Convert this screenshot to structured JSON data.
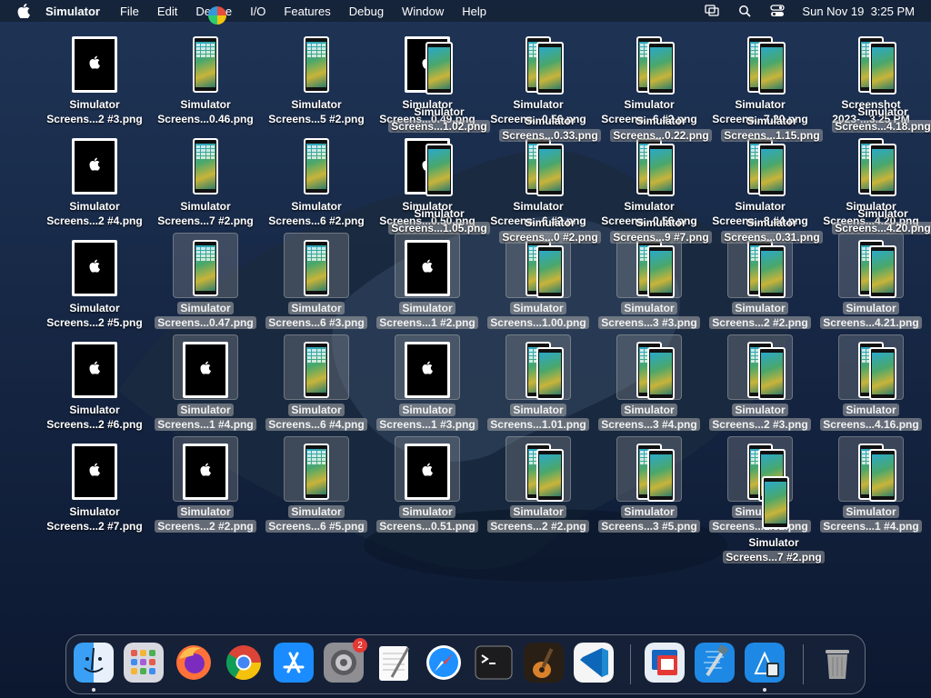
{
  "menubar": {
    "app_name": "Simulator",
    "menus": [
      "File",
      "Edit",
      "Device",
      "I/O",
      "Features",
      "Debug",
      "Window",
      "Help"
    ],
    "clock": "Sun Nov 19  3:25 PM",
    "icons": [
      "apple-icon",
      "screen-mirroring-icon",
      "spotlight-search-icon",
      "control-center-icon"
    ]
  },
  "desktop": {
    "columns": [
      [
        {
          "l1": "Simulator",
          "l2": "Screens...2 #3.png",
          "thumb": "black",
          "selected": false
        },
        {
          "l1": "Simulator",
          "l2": "Screens...2 #4.png",
          "thumb": "black",
          "selected": false
        },
        {
          "l1": "Simulator",
          "l2": "Screens...2 #5.png",
          "thumb": "black",
          "selected": false
        },
        {
          "l1": "Simulator",
          "l2": "Screens...2 #6.png",
          "thumb": "black",
          "selected": false
        },
        {
          "l1": "Simulator",
          "l2": "Screens...2 #7.png",
          "thumb": "black",
          "selected": false
        }
      ],
      [
        {
          "l1": "Simulator",
          "l2": "Screens...0.46.png",
          "thumb": "phone",
          "selected": false
        },
        {
          "l1": "Simulator",
          "l2": "Screens...7 #2.png",
          "thumb": "phone",
          "selected": false
        },
        {
          "l1": "Simulator",
          "l2": "Screens...0.47.png",
          "thumb": "phone",
          "selected": true
        },
        {
          "l1": "Simulator",
          "l2": "Screens...1 #4.png",
          "thumb": "black",
          "selected": true
        },
        {
          "l1": "Simulator",
          "l2": "Screens...2 #2.png",
          "thumb": "black",
          "selected": true
        }
      ],
      [
        {
          "l1": "Simulator",
          "l2": "Screens...5 #2.png",
          "thumb": "phone",
          "selected": false
        },
        {
          "l1": "Simulator",
          "l2": "Screens...6 #2.png",
          "thumb": "phone",
          "selected": false
        },
        {
          "l1": "Simulator",
          "l2": "Screens...6 #3.png",
          "thumb": "phone",
          "selected": true
        },
        {
          "l1": "Simulator",
          "l2": "Screens...6 #4.png",
          "thumb": "phone",
          "selected": true
        },
        {
          "l1": "Simulator",
          "l2": "Screens...6 #5.png",
          "thumb": "phone",
          "selected": true
        }
      ],
      [
        {
          "l1": "Simulator",
          "l2": "Screens...0.49.png",
          "thumb": "black",
          "selected": false
        },
        {
          "l1": "Simulator",
          "l2": "Screens...0.50.png",
          "thumb": "black",
          "selected": false
        },
        {
          "l1": "Simulator",
          "l2": "Screens...1 #2.png",
          "thumb": "black",
          "selected": true
        },
        {
          "l1": "Simulator",
          "l2": "Screens...1 #3.png",
          "thumb": "black",
          "selected": true
        },
        {
          "l1": "Simulator",
          "l2": "Screens...0.51.png",
          "thumb": "black",
          "selected": true
        }
      ],
      [
        {
          "l1": "Simulator",
          "l2": "Screens...0.56.png",
          "thumb": "phone",
          "selected": false
        },
        {
          "l1": "Simulator",
          "l2": "Screens...6 #2.png",
          "thumb": "phone",
          "selected": false
        },
        {
          "l1": "Simulator",
          "l2": "Screens...1.00.png",
          "thumb": "phone",
          "selected": true
        },
        {
          "l1": "Simulator",
          "l2": "Screens...1.01.png",
          "thumb": "phone",
          "selected": true
        },
        {
          "l1": "Simulator",
          "l2": "Screens...2 #2.png",
          "thumb": "phone",
          "selected": true
        }
      ],
      [
        {
          "l1": "Simulator",
          "l2": "Screens...6 #2.png",
          "thumb": "phone",
          "selected": false
        },
        {
          "l1": "Simulator",
          "l2": "Screens...0.56.png",
          "thumb": "phone",
          "selected": false
        },
        {
          "l1": "Simulator",
          "l2": "Screens...3 #3.png",
          "thumb": "phone",
          "selected": true
        },
        {
          "l1": "Simulator",
          "l2": "Screens...3 #4.png",
          "thumb": "phone",
          "selected": true
        },
        {
          "l1": "Simulator",
          "l2": "Screens...3 #5.png",
          "thumb": "phone",
          "selected": true
        }
      ],
      [
        {
          "l1": "Simulator",
          "l2": "Screens...7.20.png",
          "thumb": "phone",
          "selected": false
        },
        {
          "l1": "Simulator",
          "l2": "Screens...8 #4.png",
          "thumb": "phone",
          "selected": false
        },
        {
          "l1": "Simulator",
          "l2": "Screens...2 #2.png",
          "thumb": "phone",
          "selected": true
        },
        {
          "l1": "Simulator",
          "l2": "Screens...2 #3.png",
          "thumb": "phone",
          "selected": true
        },
        {
          "l1": "Simulator",
          "l2": "Screens...1.32.png",
          "thumb": "phone",
          "selected": true
        }
      ],
      [
        {
          "l1": "Screenshot",
          "l2": "2023-...3.25 PM",
          "thumb": "phone",
          "selected": false
        },
        {
          "l1": "Simulator",
          "l2": "Screens...4.20.png",
          "thumb": "phone",
          "selected": false
        },
        {
          "l1": "Simulator",
          "l2": "Screens...4.21.png",
          "thumb": "phone",
          "selected": true
        },
        {
          "l1": "Simulator",
          "l2": "Screens...4.16.png",
          "thumb": "phone",
          "selected": true
        },
        {
          "l1": "Simulator",
          "l2": "Screens...1 #4.png",
          "thumb": "phone",
          "selected": true
        }
      ]
    ],
    "overlay_labels": [
      {
        "l1": "Simulator",
        "l2": "Screens...1.02.png"
      },
      {
        "l1": "Simulator",
        "l2": "Screens...0.33.png"
      },
      {
        "l1": "Simulator",
        "l2": "Screens...0.22.png"
      },
      {
        "l1": "Simulator",
        "l2": "Screens...1.15.png"
      },
      {
        "l1": "Simulator",
        "l2": "Screens...4.18.png"
      },
      {
        "l1": "Simulator",
        "l2": "Screens...1.05.png"
      },
      {
        "l1": "Simulator",
        "l2": "Screens...0 #2.png"
      },
      {
        "l1": "Simulator",
        "l2": "Screens...9 #7.png"
      },
      {
        "l1": "Simulator",
        "l2": "Screens...0.31.png"
      },
      {
        "l1": "Simulator",
        "l2": "Screens...4.20.png"
      },
      {
        "l1": "Simulator",
        "l2": "Screens...7 #2.png"
      }
    ]
  },
  "dock": {
    "apps": [
      {
        "name": "Finder",
        "icon": "finder-icon",
        "running": true
      },
      {
        "name": "Launchpad",
        "icon": "launchpad-icon",
        "running": false
      },
      {
        "name": "Firefox",
        "icon": "firefox-icon",
        "running": false
      },
      {
        "name": "Chrome",
        "icon": "chrome-icon",
        "running": false
      },
      {
        "name": "App Store",
        "icon": "app-store-icon",
        "running": false
      },
      {
        "name": "System Settings",
        "icon": "system-settings-icon",
        "running": false,
        "badge": "2"
      },
      {
        "name": "TextEdit",
        "icon": "textedit-icon",
        "running": false
      },
      {
        "name": "Safari",
        "icon": "safari-icon",
        "running": false
      },
      {
        "name": "Terminal",
        "icon": "terminal-icon",
        "running": false
      },
      {
        "name": "GarageBand",
        "icon": "garageband-icon",
        "running": false
      },
      {
        "name": "Visual Studio Code",
        "icon": "vscode-icon",
        "running": false
      },
      {
        "name": "Remote Desktop",
        "icon": "remote-desktop-icon",
        "running": false
      },
      {
        "name": "Xcode",
        "icon": "xcode-icon",
        "running": false
      },
      {
        "name": "Simulator",
        "icon": "simulator-icon",
        "running": true
      },
      {
        "name": "Trash",
        "icon": "trash-icon",
        "running": false
      }
    ],
    "colors": {
      "accent": "#0a84ff",
      "badge": "#e53935"
    }
  }
}
